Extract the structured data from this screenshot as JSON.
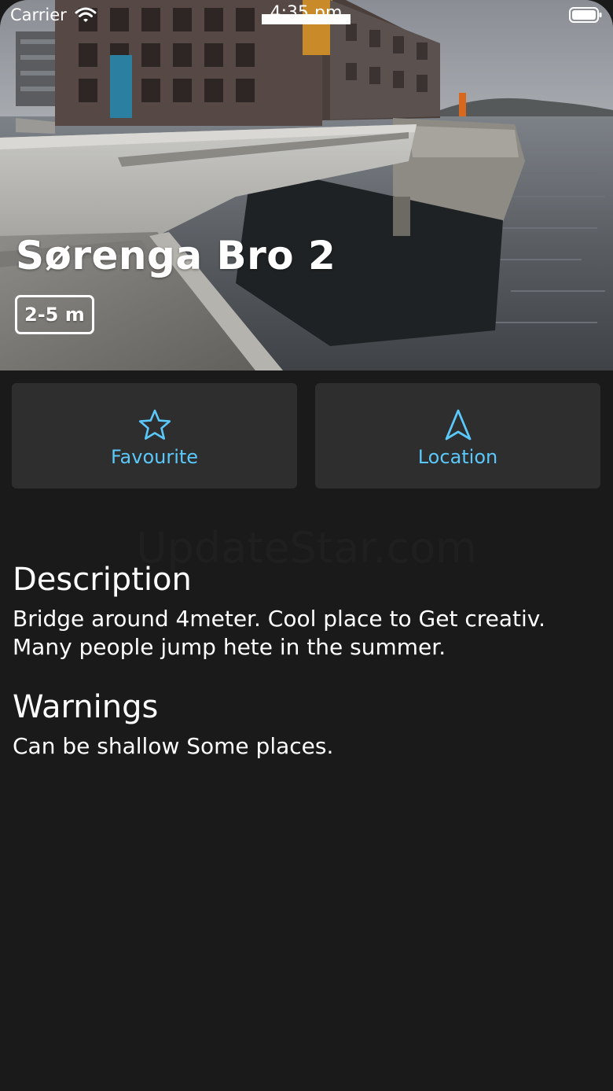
{
  "status_bar": {
    "carrier": "Carrier",
    "time": "4:35 pm"
  },
  "spot": {
    "title": "Sørenga Bro 2",
    "height_badge": "2-5 m"
  },
  "actions": {
    "favourite_label": "Favourite",
    "favourite_icon": "star-outline-icon",
    "location_label": "Location",
    "location_icon": "navigation-arrow-icon"
  },
  "watermark": "UpdateStar.com",
  "description": {
    "heading": "Description",
    "body": "Bridge around 4meter.  Cool place to Get creativ. Many people jump hete in the summer."
  },
  "warnings": {
    "heading": "Warnings",
    "body": "Can be shallow Some places."
  },
  "colors": {
    "accent": "#5ac8fa",
    "background": "#1a1a1a",
    "button_background": "#2e2e2f"
  }
}
